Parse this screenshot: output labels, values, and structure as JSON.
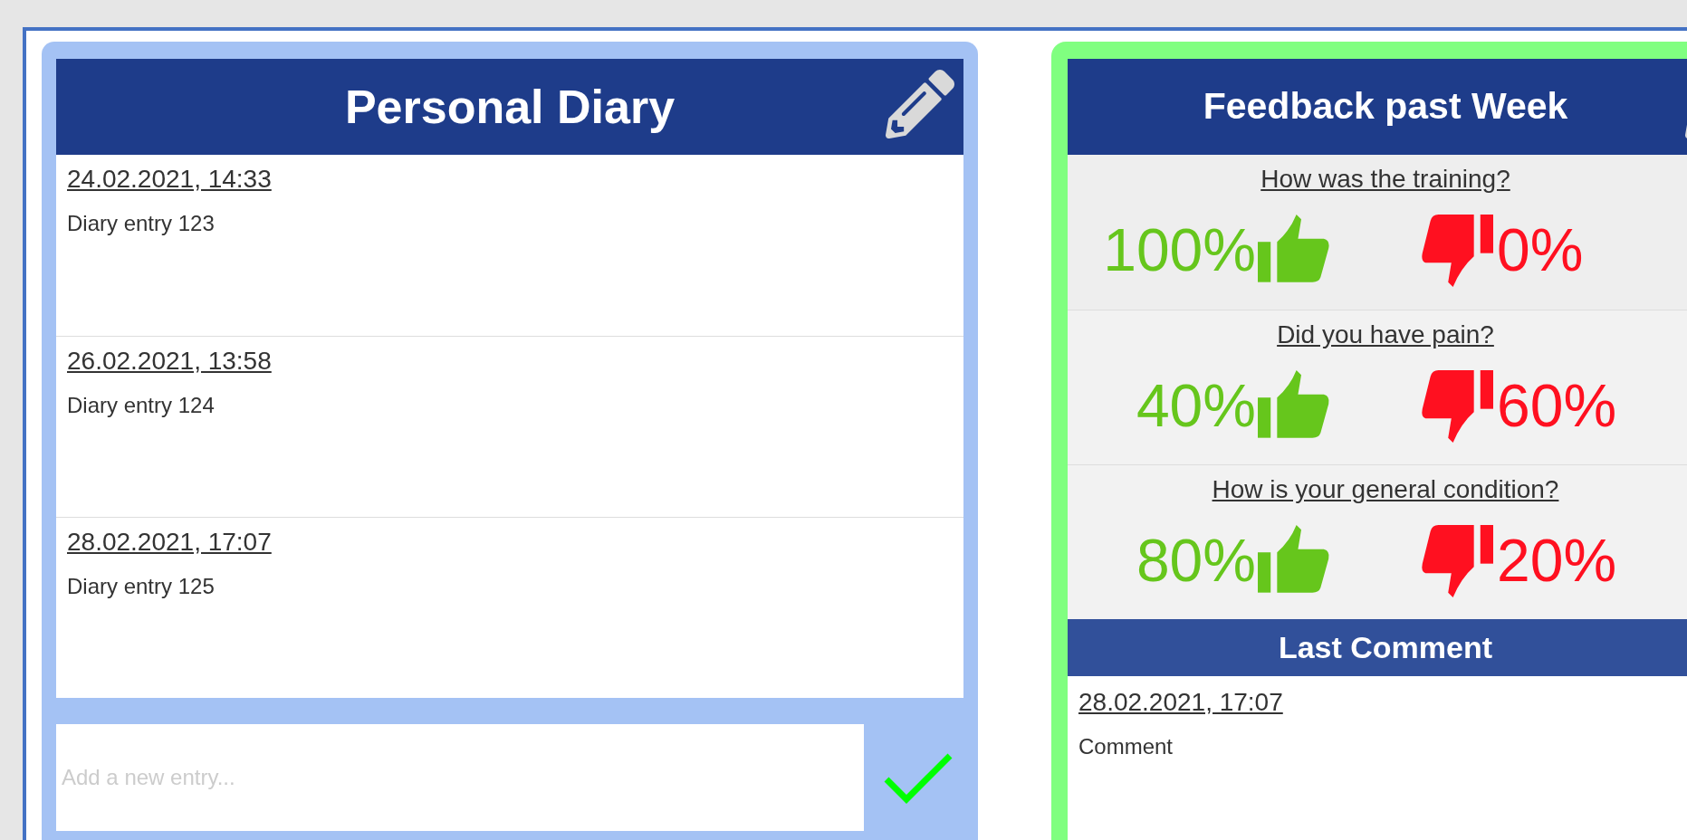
{
  "diary": {
    "title": "Personal Diary",
    "entries": [
      {
        "date": "24.02.2021, 14:33",
        "text": "Diary entry 123"
      },
      {
        "date": "26.02.2021, 13:58",
        "text": "Diary entry 124"
      },
      {
        "date": "28.02.2021, 17:07",
        "text": "Diary entry 125"
      }
    ],
    "new_entry": {
      "placeholder": "Add a new entry..."
    }
  },
  "feedback": {
    "title": "Feedback past Week",
    "questions": [
      {
        "question": "How was the training?",
        "positive": "100%",
        "negative": "0%"
      },
      {
        "question": "Did you have pain?",
        "positive": "40%",
        "negative": "60%"
      },
      {
        "question": "How is your general condition?",
        "positive": "80%",
        "negative": "20%"
      }
    ],
    "last_comment": {
      "title": "Last Comment",
      "date": "28.02.2021, 17:07",
      "text": "Comment"
    }
  }
}
